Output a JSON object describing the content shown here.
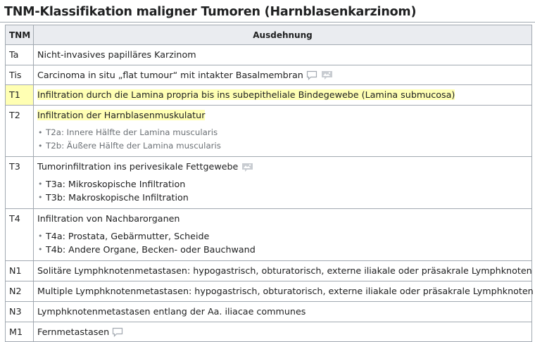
{
  "title": "TNM-Klassifikation maligner Tumoren (Harnblasenkarzinom)",
  "headers": {
    "tnm": "TNM",
    "extent": "Ausdehnung"
  },
  "rows": [
    {
      "code": "Ta",
      "text": "Nicht-invasives papilläres Karzinom"
    },
    {
      "code": "Tis",
      "text": "Carcinoma in situ „flat tumour“ mit intakter Basalmembran"
    },
    {
      "code": "T1",
      "text_hl": "Infiltration durch die Lamina propria",
      "text_rest": " bis ins subepitheliale Bindegewebe (Lamina submucosa)"
    },
    {
      "code": "T2",
      "text": "Infiltration der Harnblasenmuskulatur",
      "sub": [
        "T2a: Innere Hälfte der Lamina muscularis",
        "T2b: Äußere Hälfte der Lamina muscularis"
      ]
    },
    {
      "code": "T3",
      "text": "Tumorinfiltration ins perivesikale Fettgewebe",
      "sub": [
        "T3a: Mikroskopische Infiltration",
        "T3b: Makroskopische Infiltration"
      ]
    },
    {
      "code": "T4",
      "text": "Infiltration von Nachbarorganen",
      "sub": [
        "T4a: Prostata, Gebärmutter, Scheide",
        "T4b: Andere Organe, Becken- oder Bauchwand"
      ]
    },
    {
      "code": "N1",
      "text": "Solitäre Lymphknotenmetastasen: hypogastrisch, obturatorisch, externe iliakale oder präsakrale Lymphknoten"
    },
    {
      "code": "N2",
      "text": "Multiple Lymphknotenmetastasen: hypogastrisch, obturatorisch, externe iliakale oder präsakrale Lymphknoten"
    },
    {
      "code": "N3",
      "text": "Lymphknotenmetastasen entlang der Aa. iliacae communes"
    },
    {
      "code": "M1",
      "text": "Fernmetastasen"
    }
  ],
  "icons": {
    "comment": "comment-bubble-icon",
    "image": "image-placeholder-icon"
  },
  "colors": {
    "highlight": "#ffffb3",
    "header_bg": "#eaecf0",
    "border": "#a2a9b1"
  }
}
